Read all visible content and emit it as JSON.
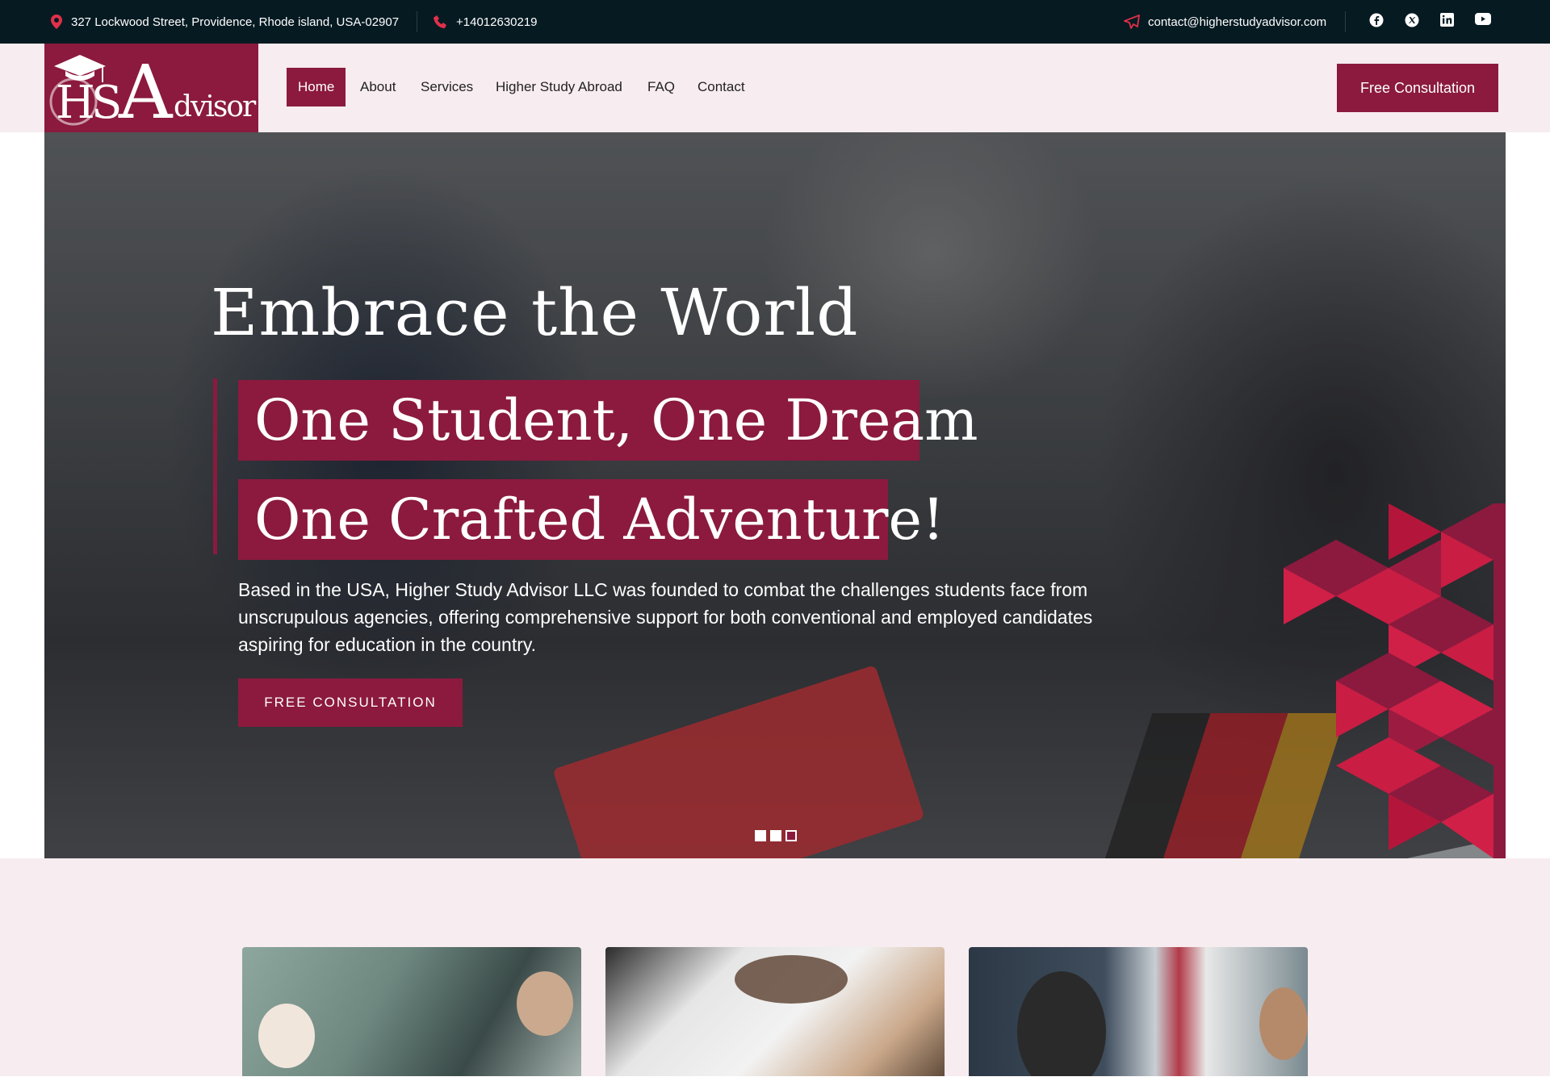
{
  "topbar": {
    "address": "327 Lockwood Street, Providence, Rhode island, USA-02907",
    "phone": "+14012630219",
    "email": "contact@higherstudyadvisor.com",
    "social": [
      "facebook-icon",
      "x-icon",
      "linkedin-icon",
      "youtube-icon"
    ]
  },
  "logo": {
    "text": "HSAdvisor"
  },
  "nav": {
    "items": [
      {
        "label": "Home",
        "active": true
      },
      {
        "label": "About"
      },
      {
        "label": "Services"
      },
      {
        "label": "Higher Study Abroad"
      },
      {
        "label": "FAQ"
      },
      {
        "label": "Contact"
      }
    ],
    "cta": "Free Consultation"
  },
  "hero": {
    "title": "Embrace the World",
    "line1": "One Student, One Dream",
    "line2": "One Crafted Adventure!",
    "description": "Based in the USA, Higher Study Advisor LLC was founded to combat the challenges students face from unscrupulous agencies, offering comprehensive support for both conventional and employed candidates aspiring for education in the country.",
    "button": "FREE CONSULTATION",
    "slides": 3,
    "active_slide": 3
  },
  "colors": {
    "brand": "#8b1a3e",
    "topbar": "#061a22",
    "header_bg": "#f7ecef"
  }
}
